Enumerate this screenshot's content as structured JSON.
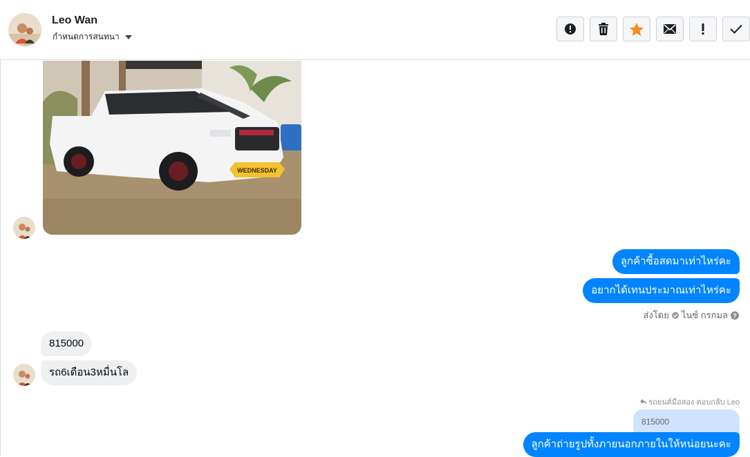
{
  "header": {
    "contact_name": "Leo Wan",
    "subtitle": "กำหนดการสนทนา",
    "actions": [
      {
        "name": "spam-button",
        "icon": "alert-circle-icon"
      },
      {
        "name": "delete-button",
        "icon": "trash-icon"
      },
      {
        "name": "star-button",
        "icon": "star-icon",
        "color": "#f68b1f"
      },
      {
        "name": "mark-unread-button",
        "icon": "envelope-icon"
      },
      {
        "name": "follow-up-button",
        "icon": "exclamation-icon"
      },
      {
        "name": "done-button",
        "icon": "check-icon"
      }
    ]
  },
  "messages": {
    "outgoing_1": "ลูกค้าซื้อสดมาเท่าไหร่คะ",
    "outgoing_2": "อยากได้เทนประมาณเท่าไหร่คะ",
    "sent_by_prefix": "ส่งโดย",
    "sent_by_name": "ไนซ์ กรกมล",
    "incoming_1": "815000",
    "incoming_2": "รถ6เดือน3หมื่นโล",
    "reply_note": "รถยนต์มือสอง ตอบกลับ Leo",
    "quoted_text": "815000",
    "outgoing_3": "ลูกค้าถ่ายรูปทั้งภายนอกภายในให้หน่อยนะคะ"
  },
  "photo": {
    "plate_text": "WEDNESDAY"
  },
  "colors": {
    "outgoing_bubble": "#0084ff",
    "incoming_bubble": "#eef0f2",
    "quoted_bubble": "#cfe3fd"
  }
}
